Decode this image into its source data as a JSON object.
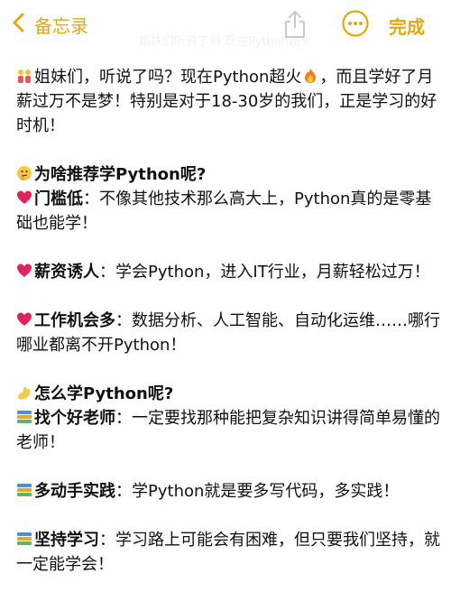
{
  "nav": {
    "back_label": "备忘录",
    "done_label": "完成",
    "ghost_title": "姐妹们听说了吗 现在Python超火",
    "accent_color": "#e2a80c",
    "icons": {
      "back": "chevron-left-icon",
      "share": "share-icon",
      "more": "ellipsis-circle-icon"
    }
  },
  "note": {
    "intro": {
      "icon": "sisters-emoji",
      "text_before_fire": "姐妹们，听说了吗？现在Python超火",
      "fire_icon": "fire-emoji",
      "text_after_fire": "，而且学好了月薪过万不是梦！特别是对于18-30岁的我们，正是学习的好时机！"
    },
    "why_heading": {
      "icon": "thinking-face-emoji",
      "text": "为啥推荐学Python呢?"
    },
    "reasons": [
      {
        "icon": "heart-emoji",
        "title": "门槛低",
        "body": "：不像其他技术那么高大上，Python真的是零基础也能学！"
      },
      {
        "icon": "heart-emoji",
        "title": "薪资诱人",
        "body": "：学会Python，进入IT行业，月薪轻松过万！"
      },
      {
        "icon": "heart-emoji",
        "title": "工作机会多",
        "body": "：数据分析、人工智能、自动化运维……哪行哪业都离不开Python！"
      }
    ],
    "how_heading": {
      "icon": "flexed-biceps-emoji",
      "text": "怎么学Python呢?"
    },
    "tips": [
      {
        "icon": "books-emoji",
        "title": "找个好老师",
        "body": "：一定要找那种能把复杂知识讲得简单易懂的老师！"
      },
      {
        "icon": "books-emoji",
        "title": "多动手实践",
        "body": "：学Python就是要多写代码，多实践！"
      },
      {
        "icon": "books-emoji",
        "title": "坚持学习",
        "body": "：学习路上可能会有困难，但只要我们坚持，就一定能学会！"
      }
    ]
  }
}
